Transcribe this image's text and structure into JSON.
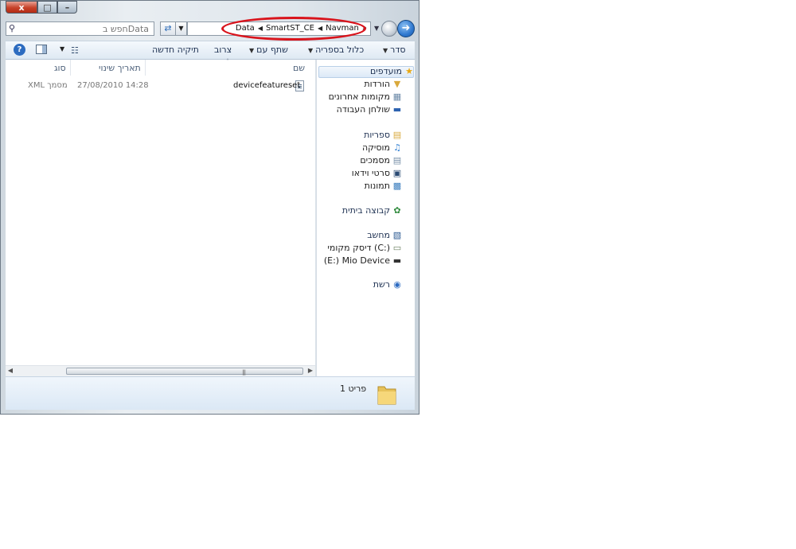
{
  "window": {
    "caption_buttons": {
      "close": "x",
      "maximize": "□",
      "minimize": "–"
    }
  },
  "address": {
    "search_placeholder": "חפש בData",
    "search_icon": "magnifier-icon",
    "refresh_icon": "refresh-icon",
    "crumbs": [
      "Data",
      "SmartST_CE",
      "Navman"
    ],
    "overflow": "»",
    "annotation_color": "#d9141c"
  },
  "toolbar": {
    "organize": "סדר",
    "include_in_library": "כלול בספריה",
    "share_with": "שתף עם",
    "burn": "צרוב",
    "new_folder": "תיקיה חדשה"
  },
  "columns": {
    "name": "שם",
    "date_modified": "תאריך שינוי",
    "type": "סוג"
  },
  "files": [
    {
      "name": "devicefeatureset",
      "date": "27/08/2010 14:28",
      "type": "XML מסמך",
      "icon": "xml-file-icon"
    }
  ],
  "nav": {
    "favorites": {
      "label": "מועדפים",
      "icon": "star-icon"
    },
    "downloads": {
      "label": "הורדות",
      "icon": "downloads-folder-icon"
    },
    "recent": {
      "label": "מקומות אחרונים",
      "icon": "recent-places-icon"
    },
    "desktop": {
      "label": "שולחן העבודה",
      "icon": "desktop-icon"
    },
    "libraries": {
      "label": "ספריות",
      "icon": "libraries-icon"
    },
    "music": {
      "label": "מוסיקה",
      "icon": "music-icon"
    },
    "documents": {
      "label": "מסמכים",
      "icon": "documents-icon"
    },
    "videos": {
      "label": "סרטי וידאו",
      "icon": "videos-icon"
    },
    "pictures": {
      "label": "תמונות",
      "icon": "pictures-icon"
    },
    "homegroup": {
      "label": "קבוצה ביתית",
      "icon": "homegroup-icon"
    },
    "computer": {
      "label": "מחשב",
      "icon": "computer-icon"
    },
    "local_disk": {
      "label": "דיסק מקומי (C:)",
      "icon": "local-disk-icon"
    },
    "mio_device": {
      "label": "(E:) Mio Device",
      "icon": "removable-drive-icon"
    },
    "network": {
      "label": "רשת",
      "icon": "network-icon"
    }
  },
  "details": {
    "item_count": "פריט 1"
  }
}
